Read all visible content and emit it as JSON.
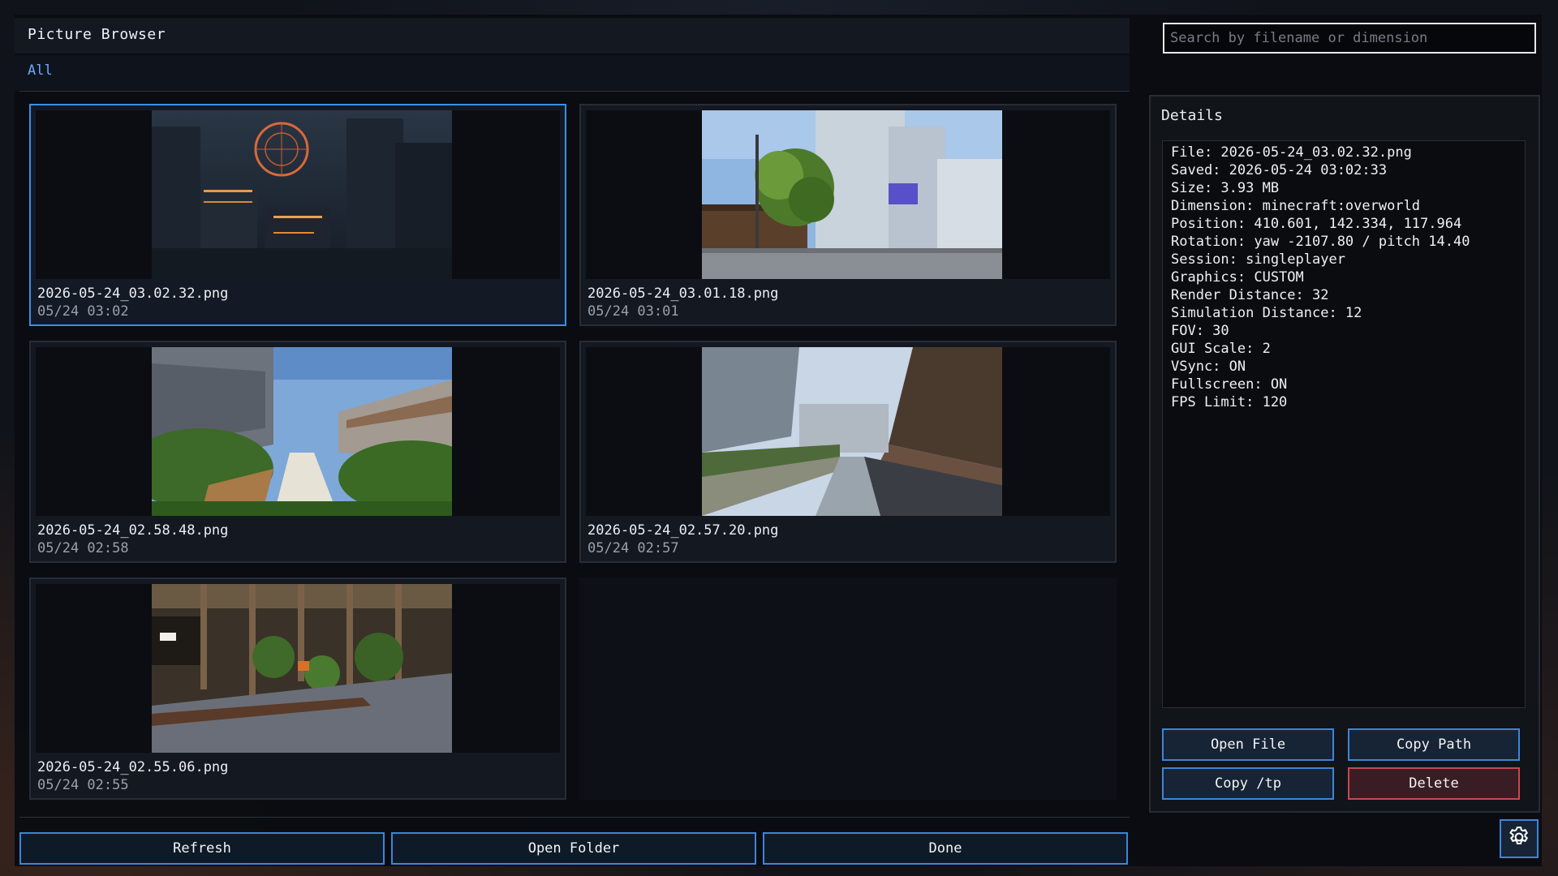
{
  "window": {
    "title": "Picture Browser"
  },
  "filters": {
    "all_label": "All"
  },
  "search": {
    "placeholder": "Search by filename or dimension",
    "value": ""
  },
  "pictures": [
    {
      "name": "2026-05-24_03.02.32.png",
      "date": "05/24 03:02",
      "selected": true,
      "thumbnail": "night-city-ferris-wheel"
    },
    {
      "name": "2026-05-24_03.01.18.png",
      "date": "05/24 03:01",
      "selected": false,
      "thumbnail": "street-tree-skyscraper"
    },
    {
      "name": "2026-05-24_02.58.48.png",
      "date": "05/24 02:58",
      "selected": false,
      "thumbnail": "garden-path-buildings"
    },
    {
      "name": "2026-05-24_02.57.20.png",
      "date": "05/24 02:57",
      "selected": false,
      "thumbnail": "street-wall-sidewalk"
    },
    {
      "name": "2026-05-24_02.55.06.png",
      "date": "05/24 02:55",
      "selected": false,
      "thumbnail": "indoor-garden-station"
    }
  ],
  "details": {
    "title": "Details",
    "lines": [
      "File: 2026-05-24_03.02.32.png",
      "Saved: 2026-05-24 03:02:33",
      "Size: 3.93 MB",
      "Dimension: minecraft:overworld",
      "Position: 410.601, 142.334, 117.964",
      "Rotation: yaw -2107.80 / pitch 14.40",
      "Session: singleplayer",
      "Graphics: CUSTOM",
      "Render Distance: 32",
      "Simulation Distance: 12",
      "FOV: 30",
      "GUI Scale: 2",
      "VSync: ON",
      "Fullscreen: ON",
      "FPS Limit: 120"
    ],
    "buttons": {
      "open_file": "Open File",
      "copy_path": "Copy Path",
      "copy_tp": "Copy /tp",
      "delete": "Delete"
    }
  },
  "footer": {
    "refresh": "Refresh",
    "open_folder": "Open Folder",
    "done": "Done"
  },
  "settings": {
    "icon": "gear-icon"
  },
  "colors": {
    "accent": "#3d85d8",
    "danger": "#c24a52",
    "link": "#6aa8ff",
    "background": "#0a0c11"
  }
}
